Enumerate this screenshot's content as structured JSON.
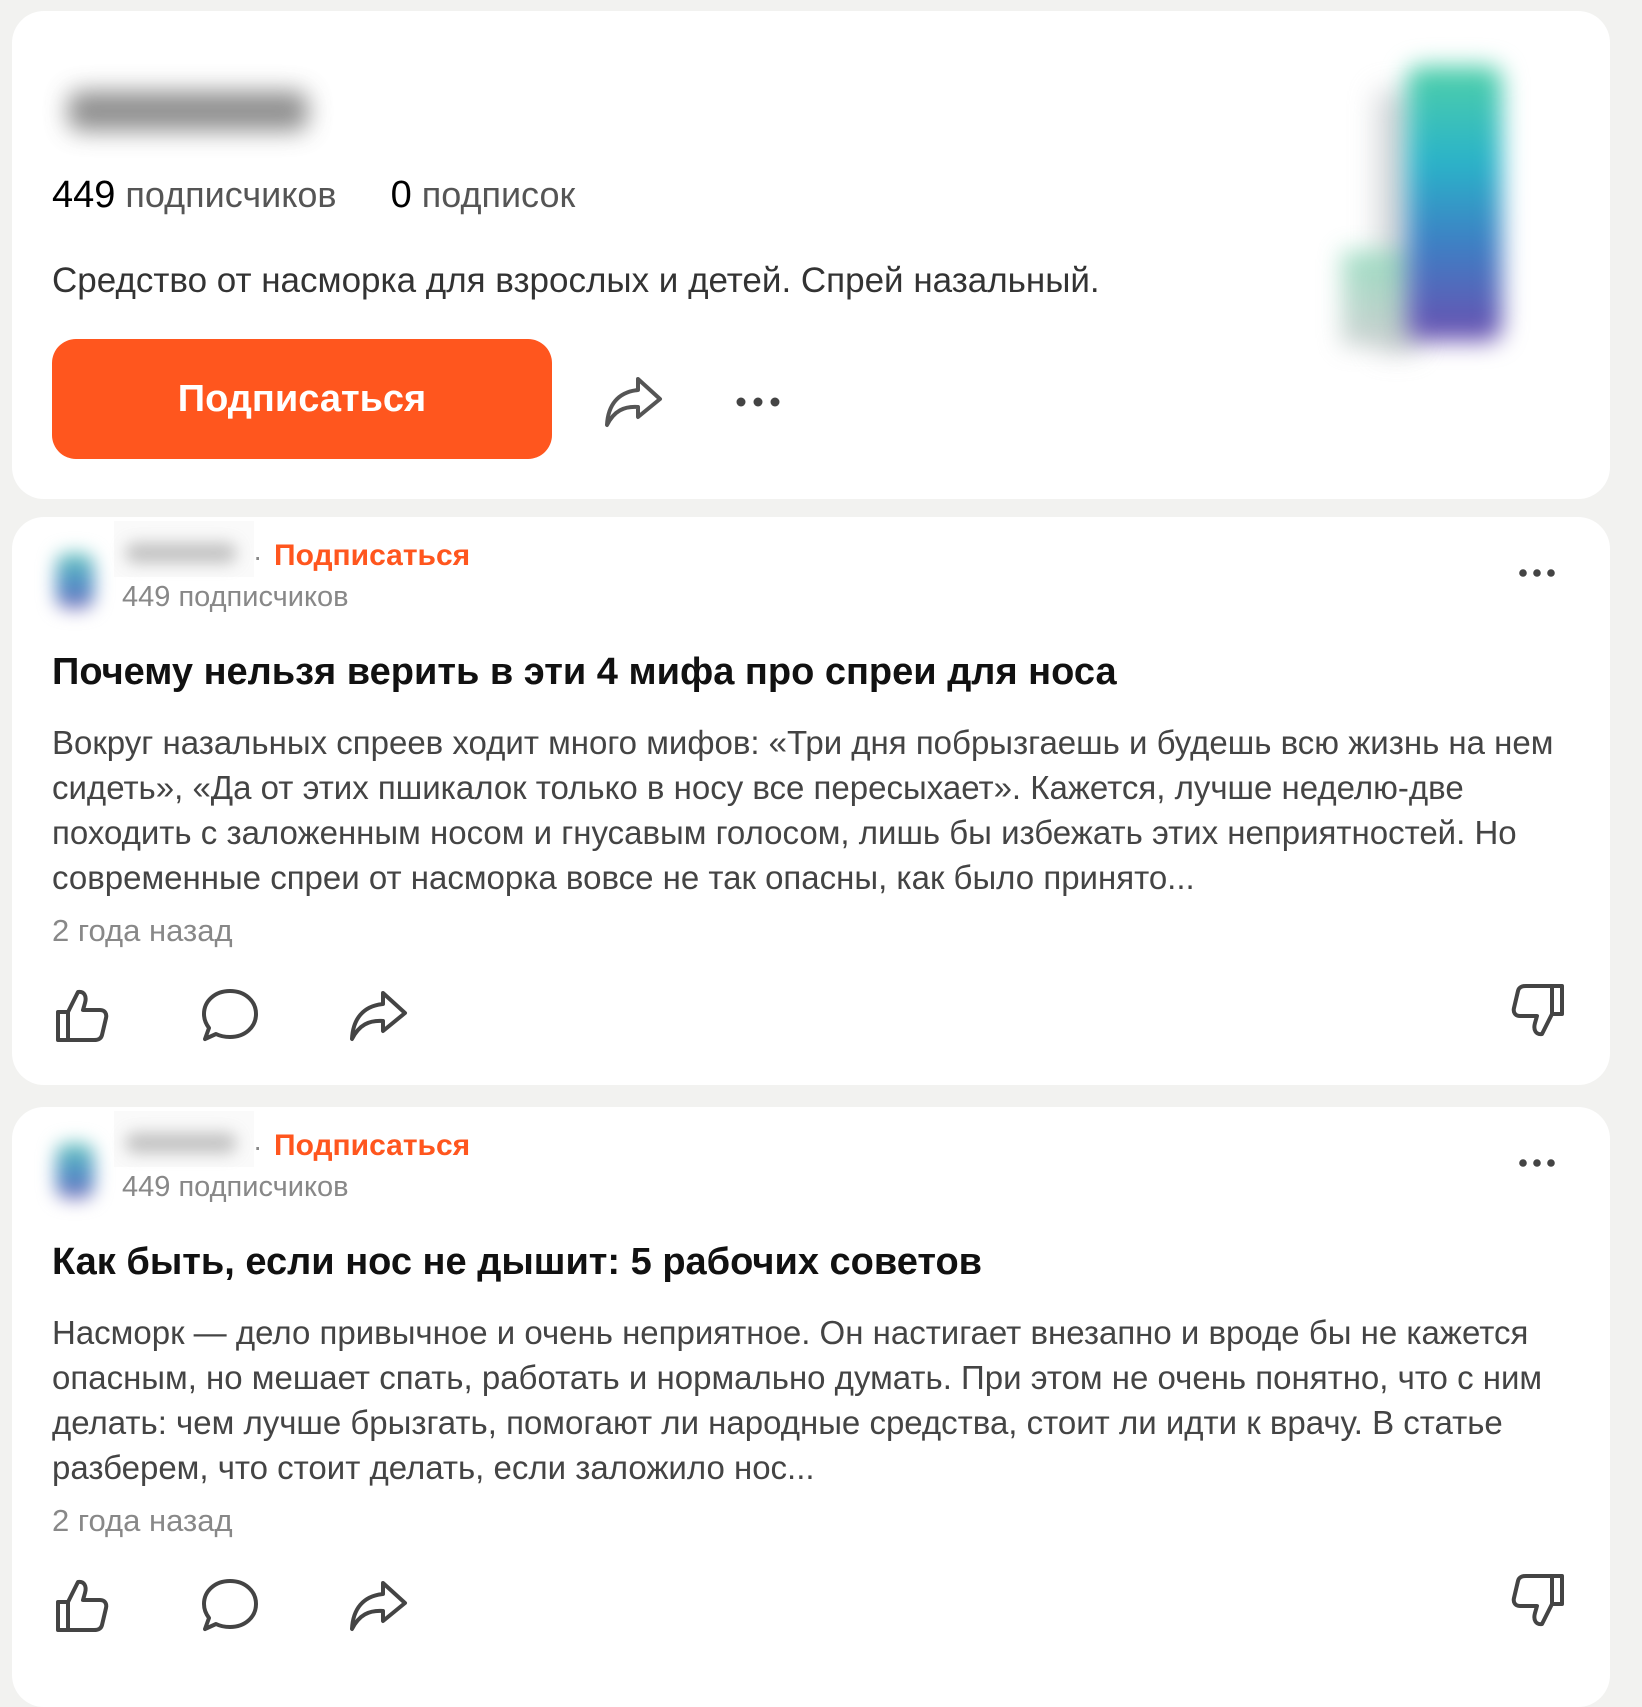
{
  "profile": {
    "followers_count": "449",
    "followers_label": "подписчиков",
    "following_count": "0",
    "following_label": "подписок",
    "description": "Средство от насморка для взрослых и детей. Спрей назальный.",
    "subscribe_label": "Подписаться"
  },
  "posts": [
    {
      "subscribe_label": "Подписаться",
      "separator": "·",
      "author_subscribers": "449 подписчиков",
      "title": "Почему нельзя верить в эти 4 мифа про спреи для носа",
      "excerpt": "Вокруг назальных спреев ходит много мифов: «Три дня побрызгаешь и будешь всю жизнь на нем сидеть», «Да от этих пшикалок только в носу все пересыхает». Кажется, лучше неделю-две походить с заложенным носом и гнусавым голосом, лишь бы избежать этих неприятностей. Но современные спреи от насморка вовсе не так опасны, как было принято...",
      "time": "2 года назад"
    },
    {
      "subscribe_label": "Подписаться",
      "separator": "·",
      "author_subscribers": "449 подписчиков",
      "title": "Как быть, если нос не дышит: 5 рабочих советов",
      "excerpt": "Насморк — дело привычное и очень неприятное. Он настигает внезапно и вроде бы не кажется опасным, но мешает спать, работать и нормально думать. При этом не очень понятно, что с ним делать: чем лучше брызгать, помогают ли народные средства, стоит ли идти к врачу. В статье разберем, что стоит делать, если заложило нос...",
      "time": "2 года назад"
    }
  ],
  "colors": {
    "accent": "#ff561e",
    "background": "#f2f2f0",
    "card": "#ffffff",
    "muted_text": "#888888"
  },
  "icons": {
    "share": "share-arrow-icon",
    "more": "more-dots-icon",
    "like": "thumbs-up-icon",
    "comment": "comment-bubble-icon",
    "dislike": "thumbs-down-icon"
  }
}
